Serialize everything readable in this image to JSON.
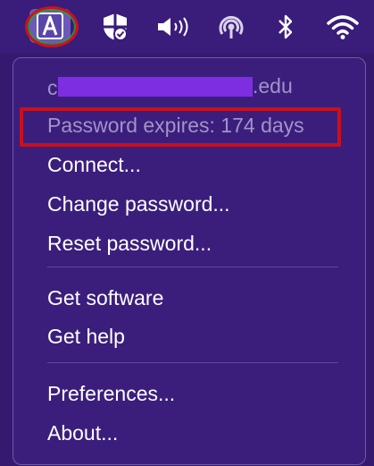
{
  "menubar": {
    "icons": [
      {
        "name": "app-icon",
        "glyph": "A"
      },
      {
        "name": "shield-check-icon"
      },
      {
        "name": "volume-icon"
      },
      {
        "name": "airdrop-icon"
      },
      {
        "name": "bluetooth-icon"
      },
      {
        "name": "wifi-icon"
      }
    ]
  },
  "menu": {
    "account_prefix": "c",
    "account_suffix": ".edu",
    "password_status": "Password expires: 174 days",
    "items_group1": [
      "Connect...",
      "Change password...",
      "Reset password..."
    ],
    "items_group2": [
      "Get software",
      "Get help"
    ],
    "items_group3": [
      "Preferences...",
      "About..."
    ]
  },
  "colors": {
    "background": "#35196e",
    "menu_bg": "#3b1e7c",
    "disabled_text": "#a492c8",
    "highlight_annotation": "#c8101e",
    "redaction": "#7d2ee0"
  }
}
